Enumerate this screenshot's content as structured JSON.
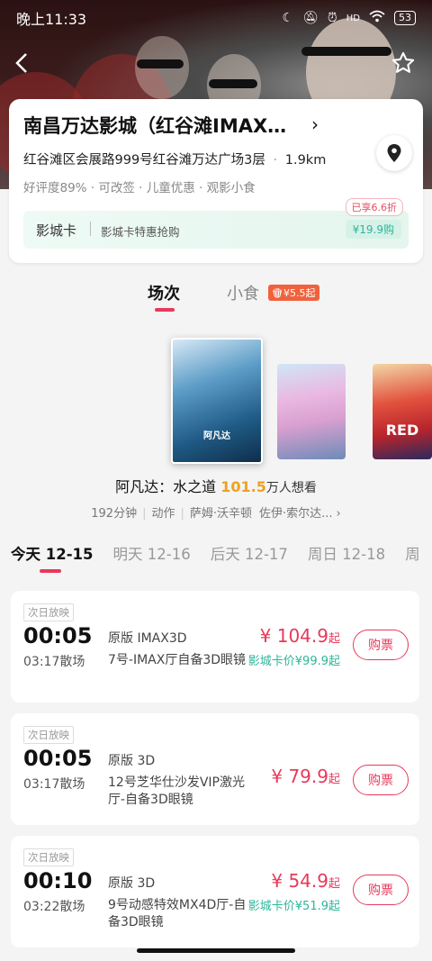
{
  "status_bar": {
    "time": "晚上11:33",
    "battery": "53",
    "icons": [
      "moon-icon",
      "mute-icon",
      "alarm-icon",
      "hd-icon",
      "wifi-icon",
      "battery-icon"
    ]
  },
  "cinema": {
    "name": "南昌万达影城（红谷滩IMAX…",
    "address": "红谷滩区会展路999号红谷滩万达广场3层",
    "distance": "1.9km",
    "tags": "好评度89% · 可改签 · 儿童优惠 · 观影小食",
    "card_banner": {
      "title": "影城卡",
      "desc": "影城卡特惠抢购",
      "badge": "已享6.6折",
      "price": "¥19.9购"
    }
  },
  "tabs": {
    "shows": "场次",
    "snacks": "小食",
    "snack_badge": "¥5.5起"
  },
  "movies": {
    "posters": [
      {
        "name": "阿凡达：水之道",
        "poster_text": "阿凡达"
      },
      {
        "name": "poster-2",
        "poster_text": ""
      },
      {
        "name": "poster-3",
        "poster_text": "RED"
      }
    ],
    "selected": {
      "title": "阿凡达：水之道",
      "score": "101.5",
      "want_label": "万人想看",
      "duration": "192分钟",
      "genre": "动作",
      "actor1": "萨姆·沃辛顿",
      "actor2": "佐伊·索尔达..."
    }
  },
  "date_tabs": [
    "今天 12-15",
    "明天 12-16",
    "后天 12-17",
    "周日 12-18",
    "周"
  ],
  "showings": [
    {
      "tag": "次日放映",
      "start": "00:05",
      "end": "03:17散场",
      "version": "原版 IMAX3D",
      "hall": "7号-IMAX厅自备3D眼镜",
      "price": "¥ 104.9",
      "price_suffix": "起",
      "card_price": "影城卡价¥99.9起",
      "buy": "购票"
    },
    {
      "tag": "次日放映",
      "start": "00:05",
      "end": "03:17散场",
      "version": "原版 3D",
      "hall": "12号芝华仕沙发VIP激光厅-自备3D眼镜",
      "price": "¥ 79.9",
      "price_suffix": "起",
      "card_price": "",
      "buy": "购票"
    },
    {
      "tag": "次日放映",
      "start": "00:10",
      "end": "03:22散场",
      "version": "原版 3D",
      "hall": "9号动感特效MX4D厅-自备3D眼镜",
      "price": "¥ 54.9",
      "price_suffix": "起",
      "card_price": "影城卡价¥51.9起",
      "buy": "购票"
    }
  ],
  "colors": {
    "accent": "#e8395a",
    "green": "#2db59a",
    "score": "#f0a020"
  }
}
